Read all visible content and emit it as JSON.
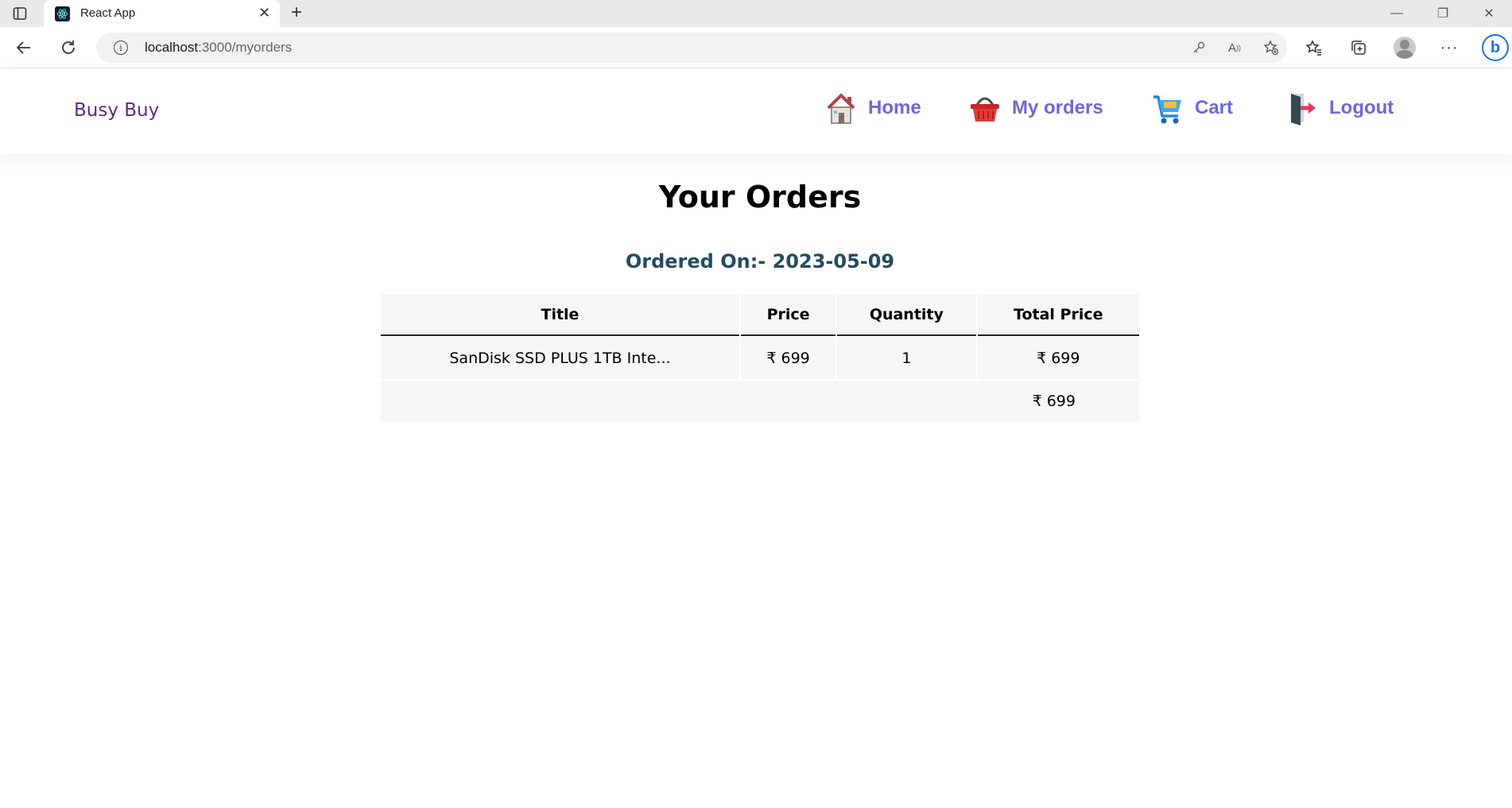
{
  "browser": {
    "tab_title": "React App",
    "url_host": "localhost",
    "url_path": ":3000/myorders",
    "icons": {
      "sidebar": "tab-sidebar-icon",
      "back": "back-arrow-icon",
      "reload": "reload-icon",
      "info": "info-icon",
      "password": "key-icon",
      "read_aloud": "read-aloud-icon",
      "add_favorite": "add-favorite-icon",
      "favorites": "favorites-icon",
      "collections": "collections-icon",
      "more": "more-icon",
      "bing": "bing-icon"
    }
  },
  "navbar": {
    "brand": "Busy Buy",
    "items": [
      {
        "label": "Home",
        "icon": "home-icon"
      },
      {
        "label": "My orders",
        "icon": "basket-icon"
      },
      {
        "label": "Cart",
        "icon": "cart-icon"
      },
      {
        "label": "Logout",
        "icon": "logout-icon"
      }
    ],
    "accent_color": "#7064e5"
  },
  "main": {
    "heading": "Your Orders",
    "orders": [
      {
        "ordered_on_label": "Ordered On:- 2023-05-09",
        "columns": [
          "Title",
          "Price",
          "Quantity",
          "Total Price"
        ],
        "rows": [
          {
            "title": "SanDisk SSD PLUS 1TB Inte...",
            "price": "₹ 699",
            "quantity": "1",
            "total": "₹ 699"
          }
        ],
        "grand_total": "₹ 699"
      }
    ]
  }
}
